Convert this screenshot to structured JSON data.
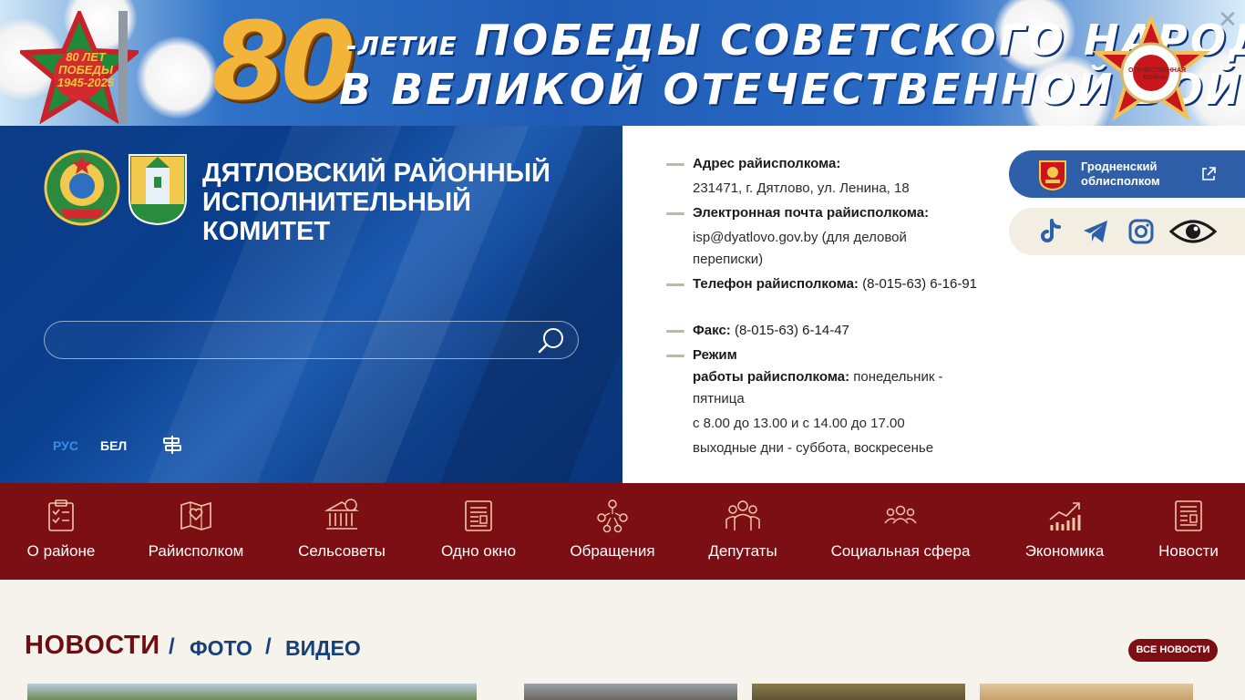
{
  "banner": {
    "number": "80",
    "line1_prefix": "-ЛЕТИЕ",
    "line1_main": "ПОБЕДЫ СОВЕТСКОГО НАРОДА",
    "line2": "В ВЕЛИКОЙ ОТЕЧЕСТВЕННОЙ ВОЙНЕ",
    "close_symbol": "✕",
    "left_badge": "80 ЛЕТ ПОБЕДЫ 1945-2025",
    "right_badge": "ОТЕЧЕСТВЕННАЯ ВОЙНА"
  },
  "header": {
    "org_title": "ДЯТЛОВСКИЙ РАЙОННЫЙ ИСПОЛНИТЕЛЬНЫЙ КОМИТЕТ",
    "search_placeholder": "",
    "lang_ru": "РУС",
    "lang_be": "БЕЛ"
  },
  "contacts": {
    "address_label": "Адрес райисполкома:",
    "address_value": "231471, г. Дятлово, ул. Ленина, 18",
    "email_label": "Электронная почта райисполкома:",
    "email_value": "isp@dyatlovo.gov.by (для деловой переписки)",
    "phone_label": "Телефон райисполкома:",
    "phone_value": "(8-015-63) 6-16-91",
    "fax_label": "Факс:",
    "fax_value": "(8-015-63) 6-14-47",
    "hours_label_1": "Режим",
    "hours_label_2": "работы райисполкома:",
    "hours_value": "понедельник - пятница",
    "hours_time": "с 8.00 до 13.00 и с 14.00 до 17.00",
    "days_off": "выходные дни - суббота, воскресенье"
  },
  "oblast_link": {
    "label": "Гродненский\nоблисполком"
  },
  "social": [
    "tiktok-icon",
    "telegram-icon",
    "instagram-icon",
    "accessibility-eye-icon"
  ],
  "nav": {
    "items": [
      {
        "label": "О районе"
      },
      {
        "label": "Райисполком"
      },
      {
        "label": "Сельсоветы"
      },
      {
        "label": "Одно окно"
      },
      {
        "label": "Обращения"
      },
      {
        "label": "Депутаты"
      },
      {
        "label": "Социальная сфера"
      },
      {
        "label": "Экономика"
      },
      {
        "label": "Новости"
      }
    ]
  },
  "news": {
    "tab_news": "НОВОСТИ",
    "tab_photo": "ФОТО",
    "tab_video": "ВИДЕО",
    "separator": "/",
    "all_news": "ВСЕ НОВОСТИ"
  },
  "colors": {
    "header_blue": "#0c3c86",
    "nav_maroon": "#7c0f14",
    "news_title": "#6e0e13",
    "link_blue": "#173f7a",
    "oblast_blue": "#2f5fa8"
  }
}
